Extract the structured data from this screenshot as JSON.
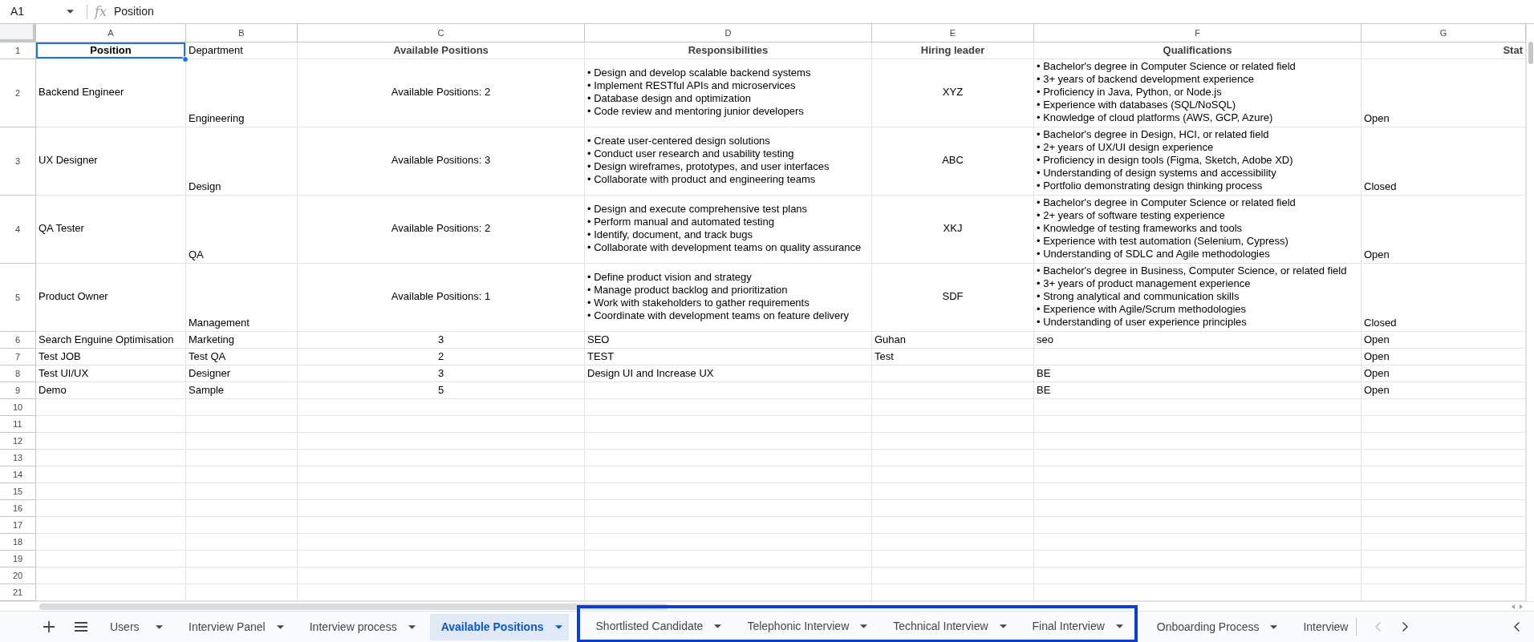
{
  "formula_bar": {
    "name_box": "A1",
    "function_symbol": "fx",
    "formula": "Position"
  },
  "columns": [
    "A",
    "B",
    "C",
    "D",
    "E",
    "F",
    "G"
  ],
  "rows": [
    {
      "number": "1",
      "cells": [
        {
          "text": "Position",
          "selected": true
        },
        {
          "text": "Department",
          "selected": false
        },
        {
          "text": "Available Positions",
          "selected": false
        },
        {
          "text": "Responsibilities",
          "selected": false
        },
        {
          "text": "Hiring leader",
          "selected": false
        },
        {
          "text": "Qualifications",
          "selected": false
        },
        {
          "text": "Stat",
          "selected": false
        }
      ]
    },
    {
      "number": "2",
      "cells": [
        {
          "text": "Backend Engineer",
          "selected": false
        },
        {
          "text": "Engineering",
          "selected": false
        },
        {
          "text": "Available Positions: 2",
          "selected": false
        },
        {
          "text": "• Design and develop scalable backend systems\n• Implement RESTful APIs and microservices\n• Database design and optimization\n• Code review and mentoring junior developers",
          "selected": false
        },
        {
          "text": "XYZ",
          "selected": false
        },
        {
          "text": "• Bachelor's degree in Computer Science or related field\n• 3+ years of backend development experience\n• Proficiency in Java, Python, or Node.js\n• Experience with databases (SQL/NoSQL)\n• Knowledge of cloud platforms (AWS, GCP, Azure)",
          "selected": false
        },
        {
          "text": "Open",
          "selected": false
        }
      ]
    },
    {
      "number": "3",
      "cells": [
        {
          "text": "UX Designer",
          "selected": false
        },
        {
          "text": "Design",
          "selected": false
        },
        {
          "text": "Available Positions: 3",
          "selected": false
        },
        {
          "text": "• Create user-centered design solutions\n• Conduct user research and usability testing\n• Design wireframes, prototypes, and user interfaces\n• Collaborate with product and engineering teams",
          "selected": false
        },
        {
          "text": "ABC",
          "selected": false
        },
        {
          "text": "• Bachelor's degree in Design, HCI, or related field\n• 2+ years of UX/UI design experience\n• Proficiency in design tools (Figma, Sketch, Adobe XD)\n• Understanding of design systems and accessibility\n• Portfolio demonstrating design thinking process",
          "selected": false
        },
        {
          "text": "Closed",
          "selected": false
        }
      ]
    },
    {
      "number": "4",
      "cells": [
        {
          "text": "QA Tester",
          "selected": false
        },
        {
          "text": "QA",
          "selected": false
        },
        {
          "text": "Available Positions: 2",
          "selected": false
        },
        {
          "text": "• Design and execute comprehensive test plans\n• Perform manual and automated testing\n• Identify, document, and track bugs\n• Collaborate with development teams on quality assurance",
          "selected": false
        },
        {
          "text": "XKJ",
          "selected": false
        },
        {
          "text": "• Bachelor's degree in Computer Science or related field\n• 2+ years of software testing experience\n• Knowledge of testing frameworks and tools\n• Experience with test automation (Selenium, Cypress)\n• Understanding of SDLC and Agile methodologies",
          "selected": false
        },
        {
          "text": "Open",
          "selected": false
        }
      ]
    },
    {
      "number": "5",
      "cells": [
        {
          "text": "Product Owner",
          "selected": false
        },
        {
          "text": "Management",
          "selected": false
        },
        {
          "text": "Available Positions: 1",
          "selected": false
        },
        {
          "text": "• Define product vision and strategy\n• Manage product backlog and prioritization\n• Work with stakeholders to gather requirements\n• Coordinate with development teams on feature delivery",
          "selected": false
        },
        {
          "text": "SDF",
          "selected": false
        },
        {
          "text": "• Bachelor's degree in Business, Computer Science, or related field\n• 3+ years of product management experience\n• Strong analytical and communication skills\n• Experience with Agile/Scrum methodologies\n• Understanding of user experience principles",
          "selected": false
        },
        {
          "text": "Closed",
          "selected": false
        }
      ]
    },
    {
      "number": "6",
      "cells": [
        {
          "text": "Search Enguine Optimisation",
          "selected": false
        },
        {
          "text": "Marketing",
          "selected": false
        },
        {
          "text": "3",
          "selected": false
        },
        {
          "text": "SEO",
          "selected": false
        },
        {
          "text": "Guhan",
          "selected": false
        },
        {
          "text": "seo",
          "selected": false
        },
        {
          "text": "Open",
          "selected": false
        }
      ]
    },
    {
      "number": "7",
      "cells": [
        {
          "text": "Test JOB",
          "selected": false
        },
        {
          "text": "Test QA",
          "selected": false
        },
        {
          "text": "2",
          "selected": false
        },
        {
          "text": "TEST",
          "selected": false
        },
        {
          "text": "Test",
          "selected": false
        },
        null,
        {
          "text": "Open",
          "selected": false
        }
      ]
    },
    {
      "number": "8",
      "cells": [
        {
          "text": "Test UI/UX",
          "selected": false
        },
        {
          "text": "Designer",
          "selected": false
        },
        {
          "text": "3",
          "selected": false
        },
        {
          "text": "Design UI and Increase UX",
          "selected": false
        },
        null,
        {
          "text": "BE",
          "selected": false
        },
        {
          "text": "Open",
          "selected": false
        }
      ]
    },
    {
      "number": "9",
      "cells": [
        {
          "text": "Demo",
          "selected": false
        },
        {
          "text": "Sample",
          "selected": false
        },
        {
          "text": "5",
          "selected": false
        },
        null,
        null,
        {
          "text": "BE",
          "selected": false
        },
        {
          "text": "Open",
          "selected": false
        }
      ]
    },
    {
      "number": "10"
    },
    {
      "number": "11"
    },
    {
      "number": "12"
    },
    {
      "number": "13"
    },
    {
      "number": "14"
    },
    {
      "number": "15"
    },
    {
      "number": "16"
    },
    {
      "number": "17"
    },
    {
      "number": "18"
    },
    {
      "number": "19"
    },
    {
      "number": "20"
    },
    {
      "number": "21"
    }
  ],
  "sheet_tabs": [
    {
      "label": "Users",
      "selected": false,
      "highlighted": false,
      "caret": true
    },
    {
      "label": "Interview Panel",
      "selected": false,
      "highlighted": false,
      "caret": true
    },
    {
      "label": "Interview process",
      "selected": false,
      "highlighted": false,
      "caret": true
    },
    {
      "label": "Available Positions",
      "selected": true,
      "highlighted": false,
      "caret": true
    },
    {
      "label": "Shortlisted Candidate",
      "selected": false,
      "highlighted": true,
      "caret": true
    },
    {
      "label": "Telephonic Interview",
      "selected": false,
      "highlighted": true,
      "caret": true
    },
    {
      "label": "Technical Interview",
      "selected": false,
      "highlighted": true,
      "caret": true
    },
    {
      "label": "Final Interview",
      "selected": false,
      "highlighted": true,
      "caret": true
    },
    {
      "label": "Onboarding Process",
      "selected": false,
      "highlighted": false,
      "caret": true
    },
    {
      "label": "Interview",
      "selected": false,
      "highlighted": false,
      "caret": false
    }
  ],
  "tab_scroll": {
    "back_disabled": true,
    "forward_disabled": false
  }
}
